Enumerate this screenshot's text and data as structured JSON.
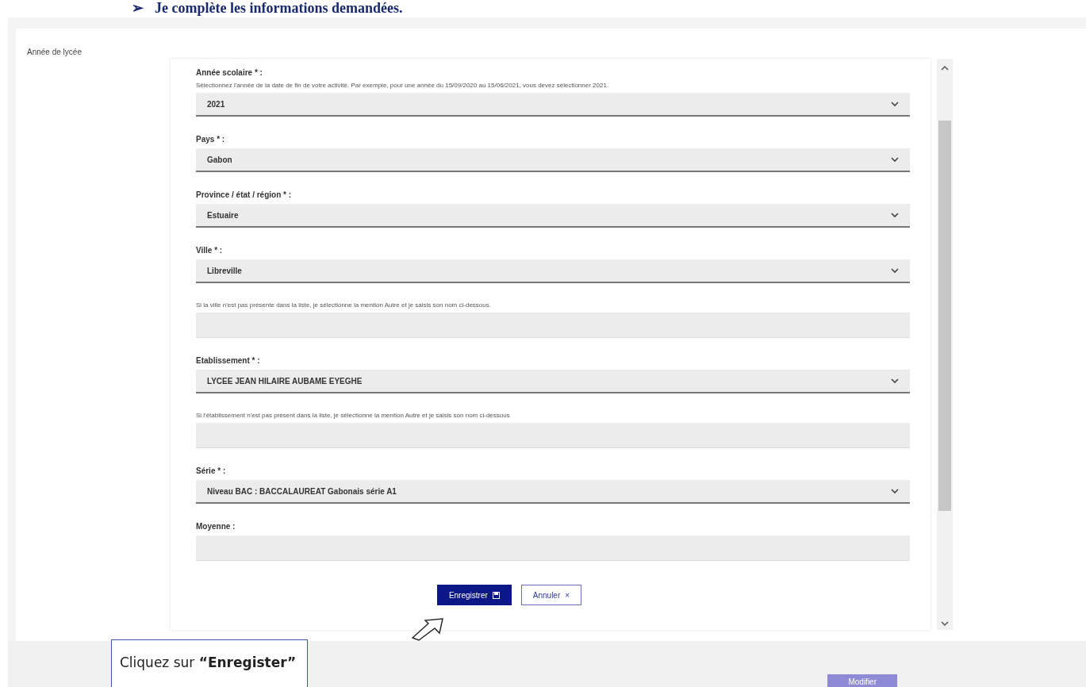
{
  "heading": {
    "marker": "➢",
    "text": "Je complète les informations demandées."
  },
  "section_label": "Année de lycée",
  "fields": [
    {
      "kind": "select",
      "label": "Année scolaire * :",
      "hint": "Sélectionnez l'année de la date de fin de votre activité. Par exemple, pour une année du 15/09/2020 au 15/06/2021, vous devez sélectionner 2021.",
      "value": "2021"
    },
    {
      "kind": "select",
      "label": "Pays * :",
      "value": "Gabon"
    },
    {
      "kind": "select",
      "label": "Province / état / région * :",
      "value": "Estuaire"
    },
    {
      "kind": "select",
      "label": "Ville * :",
      "value": "Libreville"
    },
    {
      "kind": "text",
      "hint": "Si la ville n'est pas présente dans la liste, je sélectionne la mention Autre et je saisis son nom ci-dessous."
    },
    {
      "kind": "select",
      "label": "Etablissement * :",
      "value": "LYCEE JEAN HILAIRE AUBAME EYEGHE"
    },
    {
      "kind": "text",
      "hint": "Si l'établissement n'est pas présent dans la liste, je sélectionne la mention Autre et je saisis son nom ci-dessous"
    },
    {
      "kind": "select",
      "label": "Série * :",
      "value": "Niveau BAC : BACCALAUREAT Gabonais série A1"
    },
    {
      "kind": "text",
      "label": "Moyenne :"
    }
  ],
  "buttons": [
    {
      "kind": "primary",
      "label": "Enregistrer"
    },
    {
      "kind": "secondary",
      "label": "Annuler",
      "symbol": "×"
    }
  ],
  "modify_button": {
    "label": "Modifier"
  },
  "callout": "Cliquez sur **“Enregister”**"
}
